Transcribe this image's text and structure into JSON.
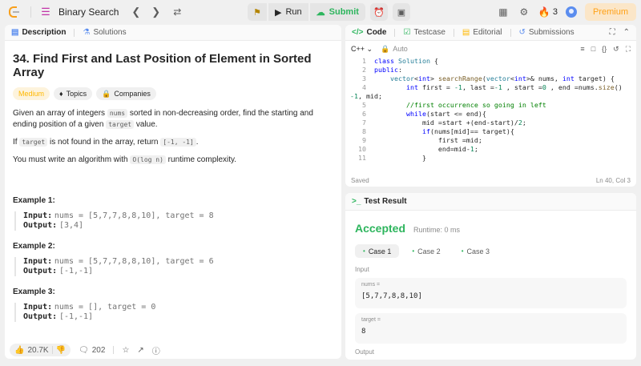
{
  "topbar": {
    "problem_list_label": "Binary Search",
    "run_label": "Run",
    "submit_label": "Submit",
    "streak_count": "3",
    "premium_label": "Premium"
  },
  "left": {
    "tabs": [
      {
        "label": "Description"
      },
      {
        "label": "Solutions"
      }
    ],
    "title": "34. Find First and Last Position of Element in Sorted Array",
    "tags": {
      "difficulty": "Medium",
      "topics": "Topics",
      "companies": "Companies"
    },
    "para1": {
      "a": "Given an array of integers ",
      "code1": "nums",
      "b": " sorted in non-decreasing order, find the starting and ending position of a given ",
      "code2": "target",
      "c": " value."
    },
    "para2": {
      "a": "If ",
      "code1": "target",
      "b": " is not found in the array, return ",
      "code2": "[-1, -1]",
      "c": "."
    },
    "para3": {
      "a": "You must write an algorithm with ",
      "code1": "O(log n)",
      "b": " runtime complexity."
    },
    "examples": [
      {
        "title": "Example 1:",
        "input_label": "Input:",
        "input": "nums = [5,7,7,8,8,10], target = 8",
        "output_label": "Output:",
        "output": "[3,4]"
      },
      {
        "title": "Example 2:",
        "input_label": "Input:",
        "input": "nums = [5,7,7,8,8,10], target = 6",
        "output_label": "Output:",
        "output": "[-1,-1]"
      },
      {
        "title": "Example 3:",
        "input_label": "Input:",
        "input": "nums = [], target = 0",
        "output_label": "Output:",
        "output": "[-1,-1]"
      }
    ],
    "footer": {
      "likes": "20.7K",
      "comments": "202"
    }
  },
  "code": {
    "tabs": [
      {
        "label": "Code"
      },
      {
        "label": "Testcase"
      },
      {
        "label": "Editorial"
      },
      {
        "label": "Submissions"
      }
    ],
    "language": "C++",
    "mode": "Auto",
    "lines": [
      {
        "n": "1"
      },
      {
        "n": "2"
      },
      {
        "n": "3"
      },
      {
        "n": "4"
      },
      {
        "n": ""
      },
      {
        "n": "5"
      },
      {
        "n": "6"
      },
      {
        "n": "7"
      },
      {
        "n": "8"
      },
      {
        "n": "9"
      },
      {
        "n": "10"
      },
      {
        "n": "11"
      }
    ],
    "status": {
      "saved": "Saved",
      "position": "Ln 40, Col 3"
    }
  },
  "result": {
    "title": "Test Result",
    "verdict": "Accepted",
    "runtime": "Runtime: 0 ms",
    "cases": [
      {
        "label": "Case 1"
      },
      {
        "label": "Case 2"
      },
      {
        "label": "Case 3"
      }
    ],
    "input_label": "Input",
    "fields": [
      {
        "name": "nums =",
        "value": "[5,7,7,8,8,10]"
      },
      {
        "name": "target =",
        "value": "8"
      }
    ],
    "output_label": "Output"
  }
}
